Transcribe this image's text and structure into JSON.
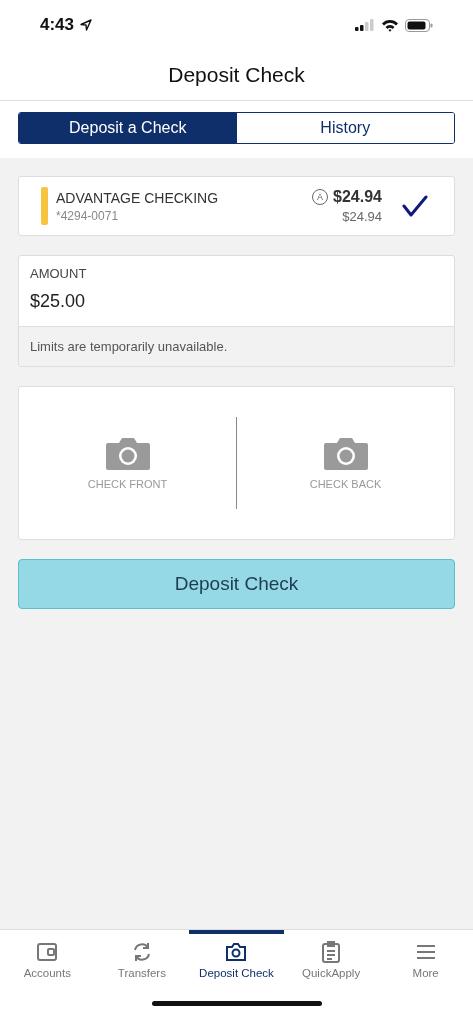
{
  "status_bar": {
    "time": "4:43"
  },
  "title": "Deposit Check",
  "tabs": [
    {
      "label": "Deposit a Check",
      "selected": true
    },
    {
      "label": "History",
      "selected": false
    }
  ],
  "account": {
    "name": "ADVANTAGE CHECKING",
    "number": "*4294-0071",
    "badge": "A",
    "balance": "$24.94",
    "available": "$24.94",
    "color": "#f5c542",
    "selected": true
  },
  "amount": {
    "label": "AMOUNT",
    "value": "$25.00",
    "note": "Limits are temporarily unavailable."
  },
  "captures": [
    {
      "label": "CHECK FRONT"
    },
    {
      "label": "CHECK BACK"
    }
  ],
  "deposit_button": "Deposit Check",
  "bottom_nav": [
    {
      "label": "Accounts",
      "kind": "wallet",
      "selected": false
    },
    {
      "label": "Transfers",
      "kind": "transfer",
      "selected": false
    },
    {
      "label": "Deposit Check",
      "kind": "camera",
      "selected": true
    },
    {
      "label": "QuickApply",
      "kind": "clipboard",
      "selected": false
    },
    {
      "label": "More",
      "kind": "menu",
      "selected": false
    }
  ]
}
